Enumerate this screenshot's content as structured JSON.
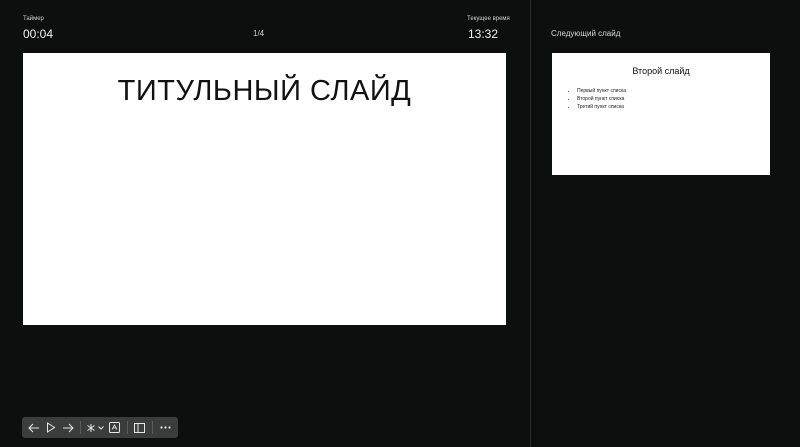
{
  "header": {
    "timer_label": "Таймер",
    "timer_value": "00:04",
    "slide_counter": "1/4",
    "clock_label": "Текущее время",
    "clock_value": "13:32"
  },
  "current_slide": {
    "title": "ТИТУЛЬНЫЙ СЛАЙД"
  },
  "next_panel": {
    "heading": "Следующий слайд",
    "slide_title": "Второй слайд",
    "bullets": [
      "Первый пункт списка",
      "Второй пункт списка",
      "Третий пункт списка"
    ]
  },
  "toolbar": {
    "icons": [
      "arrow-left-icon",
      "play-icon",
      "arrow-right-icon",
      "laser-pointer-icon",
      "chevron-down-icon",
      "subtitles-icon",
      "notes-panel-icon",
      "more-icon"
    ]
  },
  "colors": {
    "background": "#0d0e0e",
    "toolbar": "#3b3c3c",
    "slide": "#ffffff"
  }
}
